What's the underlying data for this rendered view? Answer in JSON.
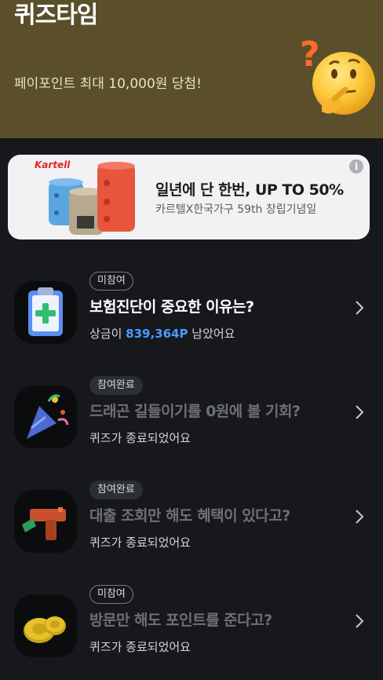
{
  "header": {
    "title": "퀴즈타임",
    "subtitle": "페이포인트 최대 10,000원 당첨!"
  },
  "banner": {
    "brand": "Kartell",
    "title": "일년에 단 한번, UP TO 50%",
    "subtitle": "카르텔X한국가구 59th 창립기념일",
    "info_icon": "i"
  },
  "quizzes": [
    {
      "badge": "미참여",
      "title": "보험진단이 중요한 이유는?",
      "status_prefix": "상금이 ",
      "prize": "839,364P",
      "status_suffix": " 남았어요",
      "icon": "clipboard-medical-icon"
    },
    {
      "badge": "참여완료",
      "title": "드래곤 길들이기를 0원에 볼 기회?",
      "status": "퀴즈가 종료되었어요",
      "icon": "party-popper-icon"
    },
    {
      "badge": "참여완료",
      "title": "대출 조회만 해도 혜택이 있다고?",
      "status": "퀴즈가 종료되었어요",
      "icon": "money-gun-icon"
    },
    {
      "badge": "미참여",
      "title": "방문만 해도 포인트를 준다고?",
      "status": "퀴즈가 종료되었어요",
      "icon": "coins-icon"
    }
  ],
  "colors": {
    "header_bg": "#5a4f2a",
    "page_bg": "#16181c",
    "prize": "#4a9bff"
  }
}
